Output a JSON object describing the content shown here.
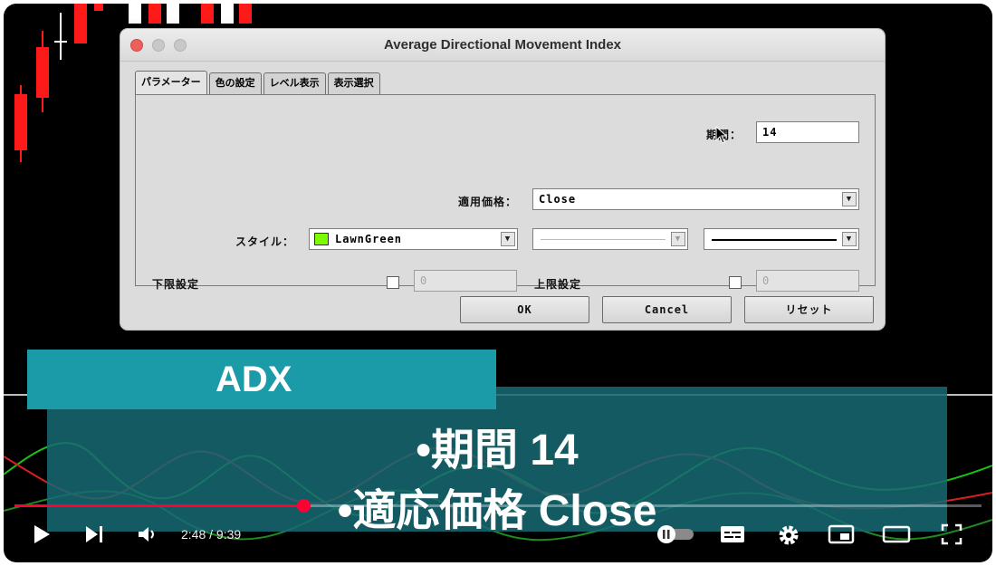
{
  "window": {
    "title": "Average Directional Movement Index"
  },
  "tabs": [
    {
      "label": "パラメーター",
      "active": true
    },
    {
      "label": "色の設定",
      "active": false
    },
    {
      "label": "レベル表示",
      "active": false
    },
    {
      "label": "表示選択",
      "active": false
    }
  ],
  "params": {
    "period_label": "期間：",
    "period_value": "14",
    "applied_price_label": "適用価格：",
    "applied_price_value": "Close",
    "style_label": "スタイル：",
    "style_color_name": "LawnGreen",
    "style_color": "#7cfc00",
    "lower_limit_label": "下限設定",
    "lower_limit_value": "0",
    "upper_limit_label": "上限設定",
    "upper_limit_value": "0"
  },
  "buttons": {
    "ok": "OK",
    "cancel": "Cancel",
    "reset": "リセット"
  },
  "overlay": {
    "title": "ADX",
    "line1": "•期間 14",
    "line2": "•適応価格 Close"
  },
  "player": {
    "time": "2:48 / 9:39",
    "progress": 0.2985
  },
  "colors": {
    "accent_red": "#ff0033",
    "overlay_teal": "#1b9aa7"
  }
}
